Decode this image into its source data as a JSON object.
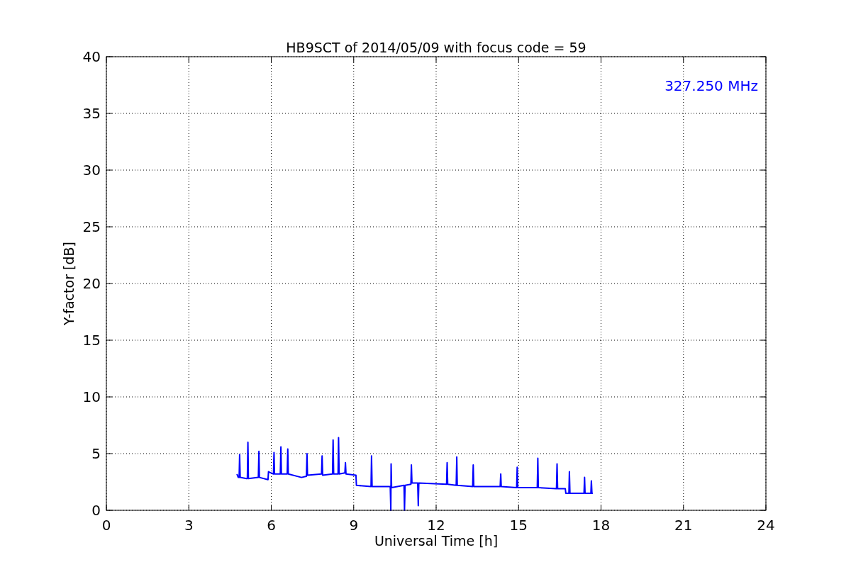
{
  "chart_data": {
    "type": "line",
    "title": "HB9SCT of 2014/05/09 with focus code = 59",
    "xlabel": "Universal Time [h]",
    "ylabel": "Y-factor [dB]",
    "xlim": [
      0,
      24
    ],
    "ylim": [
      0,
      40
    ],
    "xticks": [
      0,
      3,
      6,
      9,
      12,
      15,
      18,
      21,
      24
    ],
    "yticks": [
      0,
      5,
      10,
      15,
      20,
      25,
      30,
      35,
      40
    ],
    "x": [
      4.75,
      4.8,
      4.83,
      4.85,
      4.87,
      5.1,
      5.13,
      5.15,
      5.17,
      5.53,
      5.55,
      5.57,
      5.88,
      5.9,
      6.08,
      6.1,
      6.12,
      6.33,
      6.35,
      6.37,
      6.58,
      6.6,
      6.62,
      7.1,
      7.28,
      7.3,
      7.32,
      7.83,
      7.85,
      7.87,
      8.23,
      8.25,
      8.27,
      8.43,
      8.45,
      8.47,
      8.68,
      8.7,
      8.72,
      9.08,
      9.1,
      9.63,
      9.65,
      9.67,
      10.33,
      10.35,
      10.36,
      10.38,
      10.83,
      10.85,
      10.87,
      11.08,
      11.1,
      11.12,
      11.33,
      11.35,
      11.37,
      12.38,
      12.4,
      12.42,
      12.73,
      12.75,
      12.77,
      13.33,
      13.35,
      13.37,
      14.33,
      14.35,
      14.37,
      14.93,
      14.95,
      14.97,
      15.68,
      15.7,
      15.72,
      16.38,
      16.4,
      16.42,
      16.7,
      16.72,
      16.83,
      16.85,
      16.87,
      17.38,
      17.4,
      17.42,
      17.63,
      17.65,
      17.67,
      17.7
    ],
    "series": [
      {
        "name": "327.250 MHz",
        "color": "#0000ff",
        "values": [
          3.2,
          2.9,
          2.9,
          4.9,
          2.9,
          2.8,
          2.8,
          6.0,
          2.8,
          2.9,
          5.2,
          2.9,
          2.7,
          3.4,
          3.2,
          5.1,
          3.2,
          3.2,
          5.6,
          3.2,
          3.2,
          5.4,
          3.2,
          2.9,
          3.0,
          5.0,
          3.1,
          3.2,
          4.8,
          3.1,
          3.2,
          6.2,
          3.2,
          3.2,
          6.4,
          3.2,
          3.3,
          4.2,
          3.2,
          3.1,
          2.2,
          2.1,
          4.8,
          2.1,
          2.1,
          0,
          4.1,
          2.0,
          2.2,
          0,
          2.2,
          2.3,
          4.0,
          2.4,
          2.4,
          0.4,
          2.4,
          2.3,
          4.2,
          2.3,
          2.2,
          4.7,
          2.2,
          2.1,
          4.0,
          2.1,
          2.1,
          3.2,
          2.1,
          2.0,
          3.8,
          2.0,
          2.0,
          4.6,
          2.0,
          1.9,
          4.1,
          1.9,
          1.9,
          1.5,
          1.5,
          3.4,
          1.5,
          1.5,
          2.9,
          1.5,
          1.5,
          2.6,
          1.5,
          1.5
        ]
      }
    ],
    "grid": true
  }
}
